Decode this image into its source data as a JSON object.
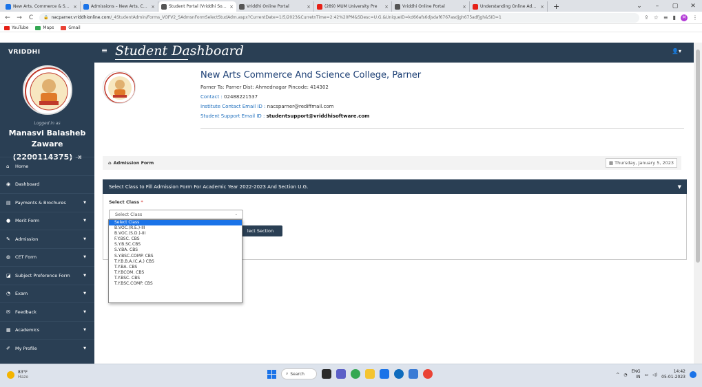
{
  "browser": {
    "tabs": [
      {
        "label": "New Arts, Commerce & Science",
        "color": "#1a73e8"
      },
      {
        "label": "Admissions – New Arts, Commerce",
        "color": "#1a73e8"
      },
      {
        "label": "Student Portal (Vriddhi Software",
        "color": "#555555"
      },
      {
        "label": "Vriddhi Online Portal",
        "color": "#555555"
      },
      {
        "label": "(289) MUM University Pre",
        "color": "#e62117"
      },
      {
        "label": "Vriddhi Online Portal",
        "color": "#555555"
      },
      {
        "label": "Understanding Online Admissio",
        "color": "#e62117"
      }
    ],
    "active_tab": 2,
    "url_host": "nacparner.vriddhionline.com",
    "url_path": "/_4StudentAdmin/Forms_VOFV2_SAdmsnFormSelectStudAdm.aspx?CurrentDate=1/5/2023&CurretnTime=2:42%20PM&SDesc=U.G.&UniqueID=kd66afs6djsdaf6767asdjgh675adfjgh&SID=1",
    "bookmarks": [
      {
        "label": "YouTube",
        "color": "#e62117"
      },
      {
        "label": "Maps",
        "color": "#34a853"
      },
      {
        "label": "Gmail",
        "color": "#ea4335"
      }
    ]
  },
  "app": {
    "brand": "VRIDDHI",
    "dashboard_title": "Student Dashboard"
  },
  "sidebar": {
    "logged_in": "Logged in as",
    "user_name": "Manasvi Balasheb Zaware",
    "user_id": "(2200114375)",
    "items": [
      {
        "label": "Home",
        "icon": "home-icon",
        "glyph": "⌂",
        "dropdown": false
      },
      {
        "label": "Dashboard",
        "icon": "dashboard-icon",
        "glyph": "◉",
        "dropdown": false
      },
      {
        "label": "Payments & Brochures",
        "icon": "payments-icon",
        "glyph": "▤",
        "dropdown": true
      },
      {
        "label": "Merit Form",
        "icon": "merit-icon",
        "glyph": "●",
        "dropdown": true
      },
      {
        "label": "Admission",
        "icon": "admission-icon",
        "glyph": "✎",
        "dropdown": true
      },
      {
        "label": "CET Form",
        "icon": "cet-icon",
        "glyph": "◍",
        "dropdown": true
      },
      {
        "label": "Subject Preference Form",
        "icon": "subject-icon",
        "glyph": "◪",
        "dropdown": true
      },
      {
        "label": "Exam",
        "icon": "exam-icon",
        "glyph": "◔",
        "dropdown": true
      },
      {
        "label": "Feedback",
        "icon": "feedback-icon",
        "glyph": "✉",
        "dropdown": true
      },
      {
        "label": "Academics",
        "icon": "academics-icon",
        "glyph": "▦",
        "dropdown": true
      },
      {
        "label": "My Profile",
        "icon": "profile-icon",
        "glyph": "✐",
        "dropdown": true
      }
    ]
  },
  "college": {
    "name": "New Arts Commerce And Science College, Parner",
    "address": "Parner Ta: Parner Dist: Ahmednagar Pincode: 414302",
    "contact_label": "Contact : ",
    "contact": "02488221537",
    "email_label": "Institute Contact Email ID : ",
    "email": "nacsparner@rediffmail.com",
    "support_label": "Student Support Email ID : ",
    "support_email": "studentsupport@vriddhisoftware.com"
  },
  "breadcrumb": {
    "label": "Admission Form",
    "date": "Thursday, January 5, 2023"
  },
  "form": {
    "heading": "Select Class to Fill Admission Form For Academic Year 2022-2023 And Section U.G.",
    "select_label": "Select Class",
    "required_mark": "*",
    "selected_value": "Select Class",
    "button_label": "lect Section",
    "options": [
      "Select Class",
      "B.VOC.(R.E.)-III",
      "B.VOC.(S.D.)-III",
      "F.Y.BSC. CBS",
      "S.Y.B.SC.CBS",
      "S.Y.BA. CBS",
      "S.Y.BSC.COMP. CBS",
      "T.Y.B.B.A.(C.A.) CBS",
      "T.Y.BA. CBS",
      "T.Y.BCOM. CBS",
      "T.Y.BSC. CBS",
      "T.Y.BSC.COMP. CBS"
    ]
  },
  "taskbar": {
    "temp": "83°F",
    "weather": "Haze",
    "search": "Search",
    "lang": "ENG",
    "region": "IN",
    "time": "14:42",
    "date": "05-01-2023"
  }
}
